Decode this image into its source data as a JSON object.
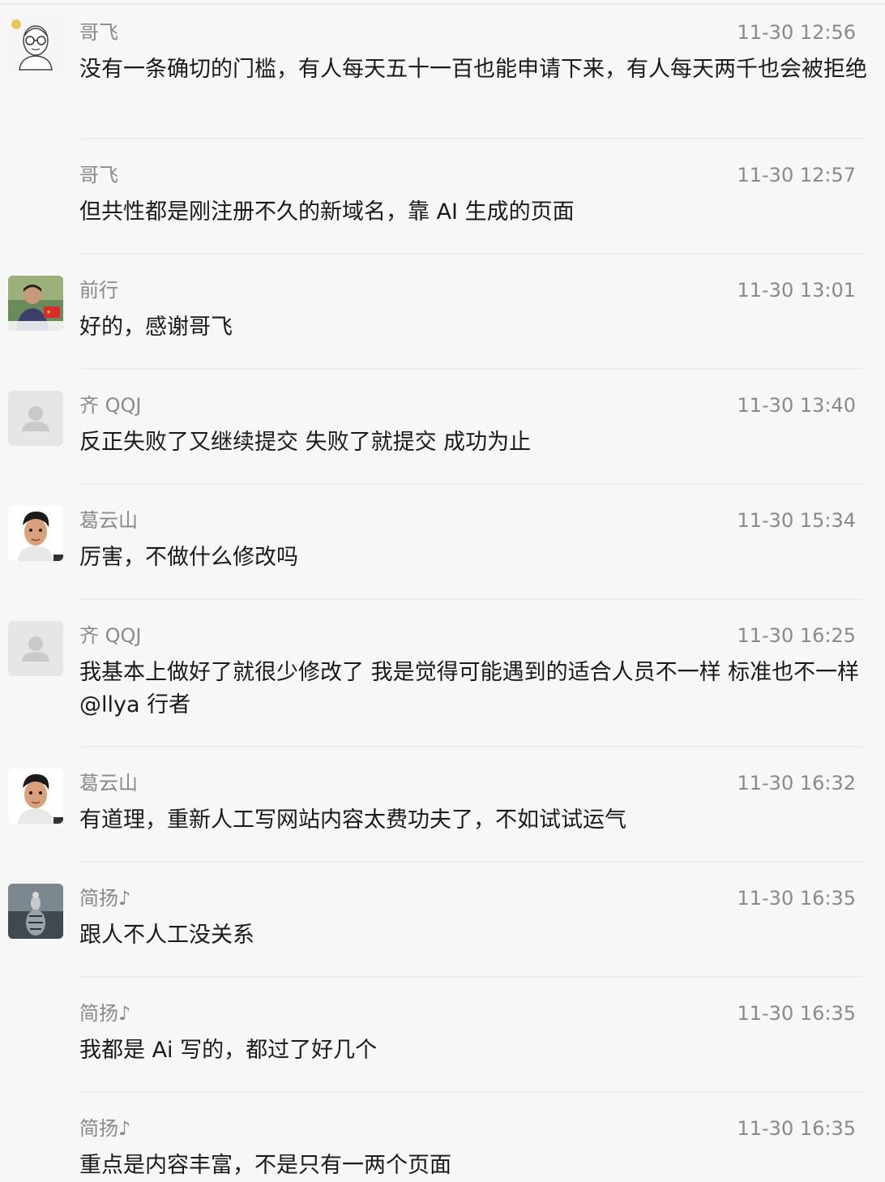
{
  "messages": [
    {
      "avatar": "cartoon-man-glasses-avatar",
      "name": "哥飞",
      "time": "11-30 12:56",
      "text": "没有一条确切的门槛，有人每天五十一百也能申请下来，有人每天两千也会被拒绝"
    },
    {
      "avatar": "",
      "name": "哥飞",
      "time": "11-30 12:57",
      "text": "但共性都是刚注册不久的新域名，靠 AI 生成的页面"
    },
    {
      "avatar": "photo-man-flag-avatar",
      "name": "前行",
      "time": "11-30 13:01",
      "text": "好的，感谢哥飞"
    },
    {
      "avatar": "default-user-avatar",
      "name": "齐 QQJ",
      "time": "11-30 13:40",
      "text": "反正失败了又继续提交 失败了就提交 成功为止"
    },
    {
      "avatar": "3d-young-man-avatar",
      "name": "葛云山",
      "time": "11-30 15:34",
      "text": "厉害，不做什么修改吗"
    },
    {
      "avatar": "default-user-avatar",
      "name": "齐 QQJ",
      "time": "11-30 16:25",
      "text": "我基本上做好了就很少修改了 我是觉得可能遇到的适合人员不一样 标准也不一样 @llya 行者"
    },
    {
      "avatar": "3d-young-man-avatar",
      "name": "葛云山",
      "time": "11-30 16:32",
      "text": "有道理，重新人工写网站内容太费功夫了，不如试试运气"
    },
    {
      "avatar": "cat-tiger-reflection-avatar",
      "name": "简扬♪",
      "time": "11-30 16:35",
      "text": "跟人不人工没关系"
    },
    {
      "avatar": "",
      "name": "简扬♪",
      "time": "11-30 16:35",
      "text": "我都是 Ai 写的，都过了好几个"
    },
    {
      "avatar": "",
      "name": "简扬♪",
      "time": "11-30 16:35",
      "text": "重点是内容丰富，不是只有一两个页面"
    }
  ]
}
